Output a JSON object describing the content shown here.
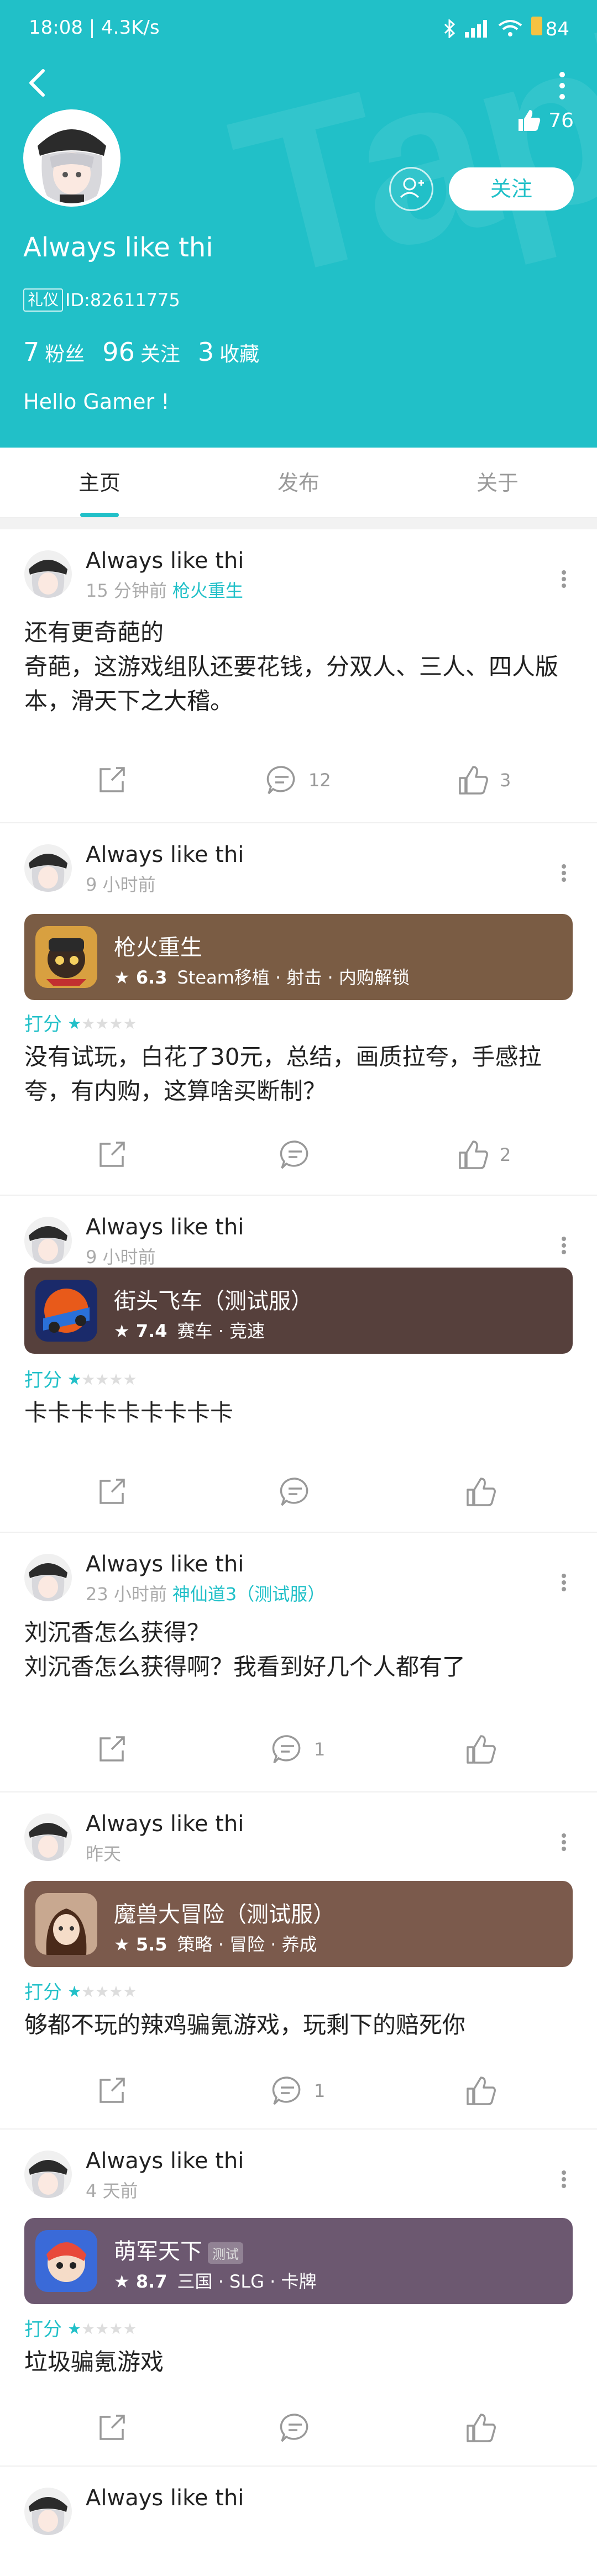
{
  "status_bar": {
    "time": "18:08 | 4.3K/s",
    "battery": "84"
  },
  "profile": {
    "like_count": "76",
    "follow_label": "关注",
    "username": "Always like thi",
    "tag": "礼仪",
    "id_text": "ID:82611775",
    "stats": [
      {
        "num": "7",
        "label": "粉丝"
      },
      {
        "num": "96",
        "label": "关注"
      },
      {
        "num": "3",
        "label": "收藏"
      }
    ],
    "bio": "Hello Gamer !"
  },
  "tabs": [
    "主页",
    "发布",
    "关于"
  ],
  "posts": [
    {
      "name": "Always like thi",
      "time": "15 分钟前",
      "game": "枪火重生",
      "lines": [
        "还有更奇葩的",
        "奇葩，这游戏组队还要花钱，分双人、三人、四人版",
        "本，滑天下之大稽。"
      ],
      "comments": "12",
      "likes": "3"
    },
    {
      "name": "Always like thi",
      "time": "9 小时前",
      "card": {
        "title": "枪火重生",
        "score": "6.3",
        "tags": "Steam移植 · 射击 · 内购解锁",
        "bg": "#7a5c44",
        "test": ""
      },
      "rating_label": "打分",
      "rating": 1,
      "lines": [
        "没有试玩，白花了30元，总结，画质拉夸，手感拉",
        "夸，有内购，这算啥买断制？"
      ],
      "comments": "",
      "likes": "2"
    },
    {
      "name": "Always like thi",
      "time": "9 小时前",
      "card": {
        "title": "街头飞车（测试服）",
        "score": "7.4",
        "tags": "赛车 · 竞速",
        "bg": "#56403c",
        "test": ""
      },
      "rating_label": "打分",
      "rating": 1,
      "lines": [
        "卡卡卡卡卡卡卡卡卡"
      ],
      "comments": "",
      "likes": ""
    },
    {
      "name": "Always like thi",
      "time": "23 小时前",
      "game": "神仙道3（测试服）",
      "lines": [
        "刘沉香怎么获得？",
        "刘沉香怎么获得啊？我看到好几个人都有了"
      ],
      "comments": "1",
      "likes": ""
    },
    {
      "name": "Always like thi",
      "time": "昨天",
      "card": {
        "title": "魔兽大冒险（测试服）",
        "score": "5.5",
        "tags": "策略 · 冒险 · 养成",
        "bg": "#7b5a4c",
        "test": ""
      },
      "rating_label": "打分",
      "rating": 1,
      "lines": [
        "够都不玩的辣鸡骗氪游戏，玩剩下的赔死你"
      ],
      "comments": "1",
      "likes": ""
    },
    {
      "name": "Always like thi",
      "time": "4 天前",
      "card": {
        "title": "萌军天下",
        "score": "8.7",
        "tags": "三国 · SLG · 卡牌",
        "bg": "#6c5870",
        "test": "测试"
      },
      "rating_label": "打分",
      "rating": 1,
      "lines": [
        "垃圾骗氪游戏"
      ],
      "comments": "",
      "likes": ""
    },
    {
      "name": "Always like thi",
      "time": "",
      "lines": [],
      "comments": "",
      "likes": ""
    }
  ]
}
